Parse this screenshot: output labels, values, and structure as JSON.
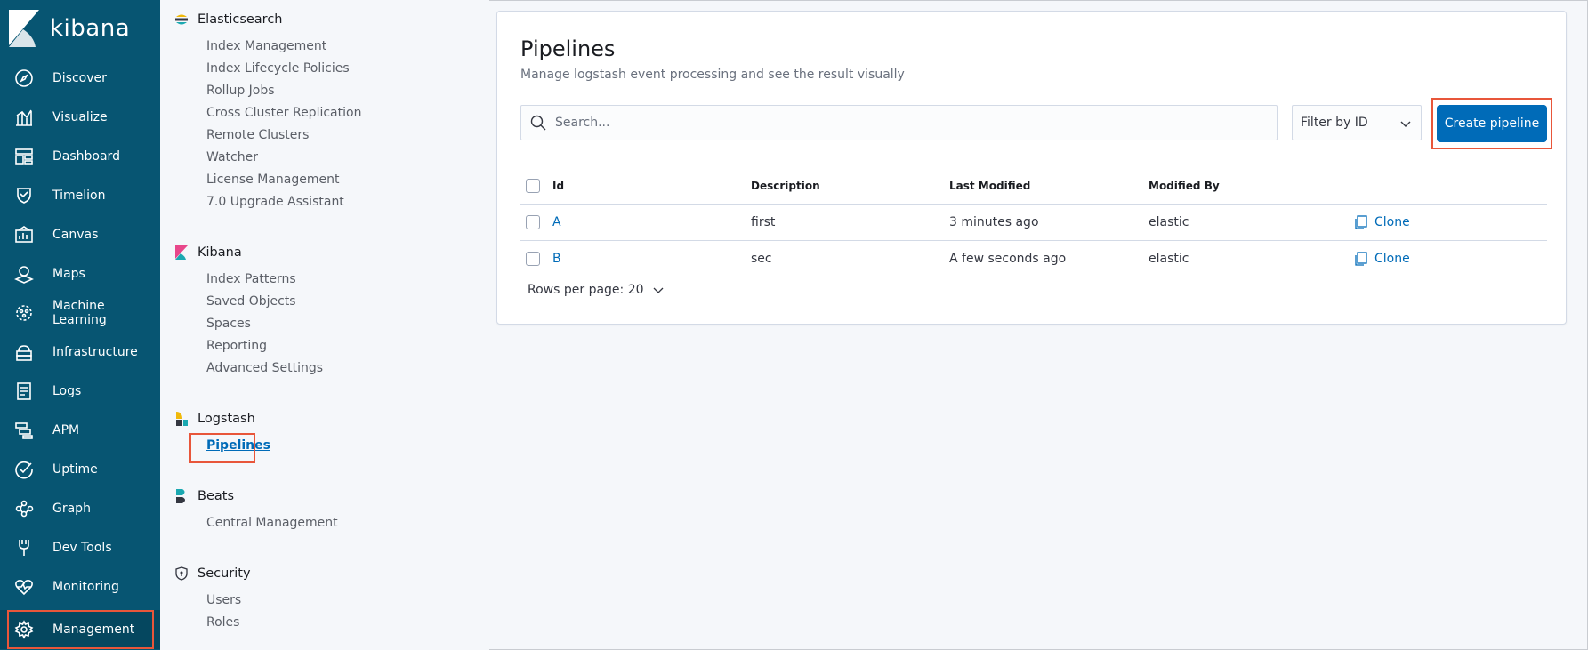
{
  "app": {
    "name": "kibana"
  },
  "nav": {
    "items": [
      {
        "label": "Discover",
        "icon": "compass-icon"
      },
      {
        "label": "Visualize",
        "icon": "visualize-icon"
      },
      {
        "label": "Dashboard",
        "icon": "dashboard-icon"
      },
      {
        "label": "Timelion",
        "icon": "timelion-icon"
      },
      {
        "label": "Canvas",
        "icon": "canvas-icon"
      },
      {
        "label": "Maps",
        "icon": "maps-icon"
      },
      {
        "label": "Machine Learning",
        "icon": "machine-learning-icon"
      },
      {
        "label": "Infrastructure",
        "icon": "infrastructure-icon"
      },
      {
        "label": "Logs",
        "icon": "logs-icon"
      },
      {
        "label": "APM",
        "icon": "apm-icon"
      },
      {
        "label": "Uptime",
        "icon": "uptime-icon"
      },
      {
        "label": "Graph",
        "icon": "graph-icon"
      },
      {
        "label": "Dev Tools",
        "icon": "dev-tools-icon"
      },
      {
        "label": "Monitoring",
        "icon": "monitoring-icon"
      },
      {
        "label": "Management",
        "icon": "gear-icon",
        "active": true
      }
    ]
  },
  "mgmt": {
    "elasticsearch": {
      "title": "Elasticsearch",
      "links": [
        "Index Management",
        "Index Lifecycle Policies",
        "Rollup Jobs",
        "Cross Cluster Replication",
        "Remote Clusters",
        "Watcher",
        "License Management",
        "7.0 Upgrade Assistant"
      ]
    },
    "kibana": {
      "title": "Kibana",
      "links": [
        "Index Patterns",
        "Saved Objects",
        "Spaces",
        "Reporting",
        "Advanced Settings"
      ]
    },
    "logstash": {
      "title": "Logstash",
      "links": [
        "Pipelines"
      ]
    },
    "beats": {
      "title": "Beats",
      "links": [
        "Central Management"
      ]
    },
    "security": {
      "title": "Security",
      "links": [
        "Users",
        "Roles"
      ]
    }
  },
  "page": {
    "title": "Pipelines",
    "subtitle": "Manage logstash event processing and see the result visually",
    "search_placeholder": "Search...",
    "filter_label": "Filter by ID",
    "create_label": "Create pipeline",
    "columns": {
      "id": "Id",
      "description": "Description",
      "last_modified": "Last Modified",
      "modified_by": "Modified By"
    },
    "rows": [
      {
        "id": "A",
        "description": "first",
        "last_modified": "3 minutes ago",
        "modified_by": "elastic",
        "action": "Clone"
      },
      {
        "id": "B",
        "description": "sec",
        "last_modified": "A few seconds ago",
        "modified_by": "elastic",
        "action": "Clone"
      }
    ],
    "rows_per_page": "Rows per page: 20"
  },
  "colors": {
    "nav_bg": "#075572",
    "accent": "#006bb8",
    "highlight": "#e8563a"
  }
}
